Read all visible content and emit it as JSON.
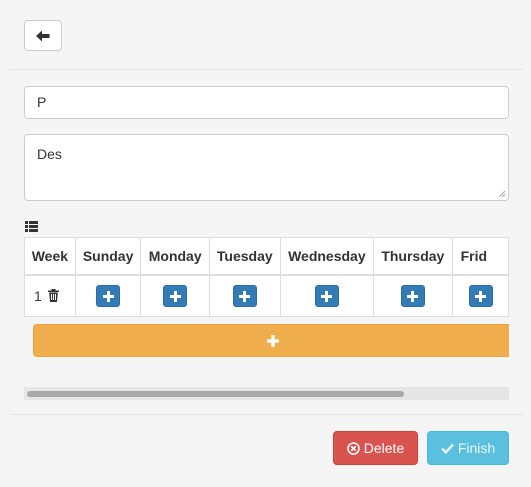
{
  "form": {
    "name_value": "P",
    "description_value": "Des"
  },
  "schedule": {
    "columns": [
      "Week",
      "Sunday",
      "Monday",
      "Tuesday",
      "Wednesday",
      "Thursday",
      "Frid"
    ],
    "rows": [
      {
        "week": "1"
      }
    ]
  },
  "actions": {
    "delete_label": "Delete",
    "finish_label": "Finish"
  },
  "colors": {
    "primary": "#337ab7",
    "warning": "#f0ad4e",
    "danger": "#d9534f",
    "info": "#5bc0de"
  },
  "icons": {
    "back": "arrow-left-icon",
    "list": "list-icon",
    "trash": "trash-icon",
    "add": "plus-icon",
    "delete": "times-circle-icon",
    "finish": "check-icon"
  }
}
